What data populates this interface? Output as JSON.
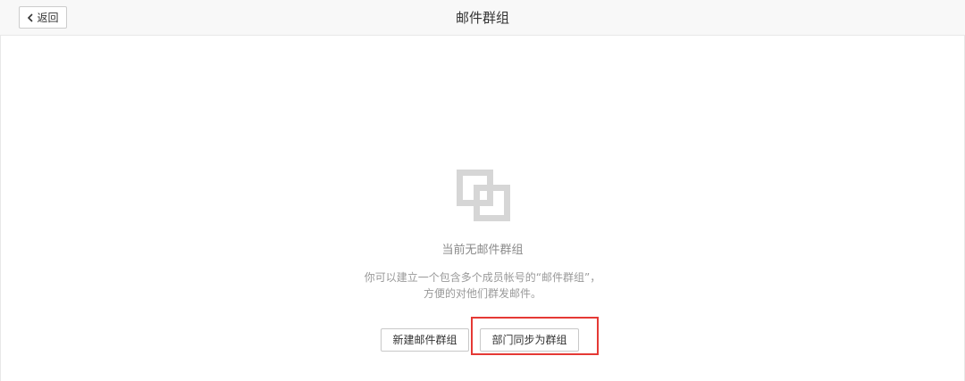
{
  "header": {
    "back_label": "返回",
    "title": "邮件群组"
  },
  "empty_state": {
    "icon": "overlapping-squares-icon",
    "title": "当前无邮件群组",
    "description_line1": "你可以建立一个包含多个成员帐号的“邮件群组”，",
    "description_line2": "方便的对他们群发邮件。"
  },
  "actions": {
    "new_group_label": "新建邮件群组",
    "sync_department_label": "部门同步为群组"
  },
  "colors": {
    "highlight": "#e53935",
    "icon_gray": "#d6d6d6"
  }
}
